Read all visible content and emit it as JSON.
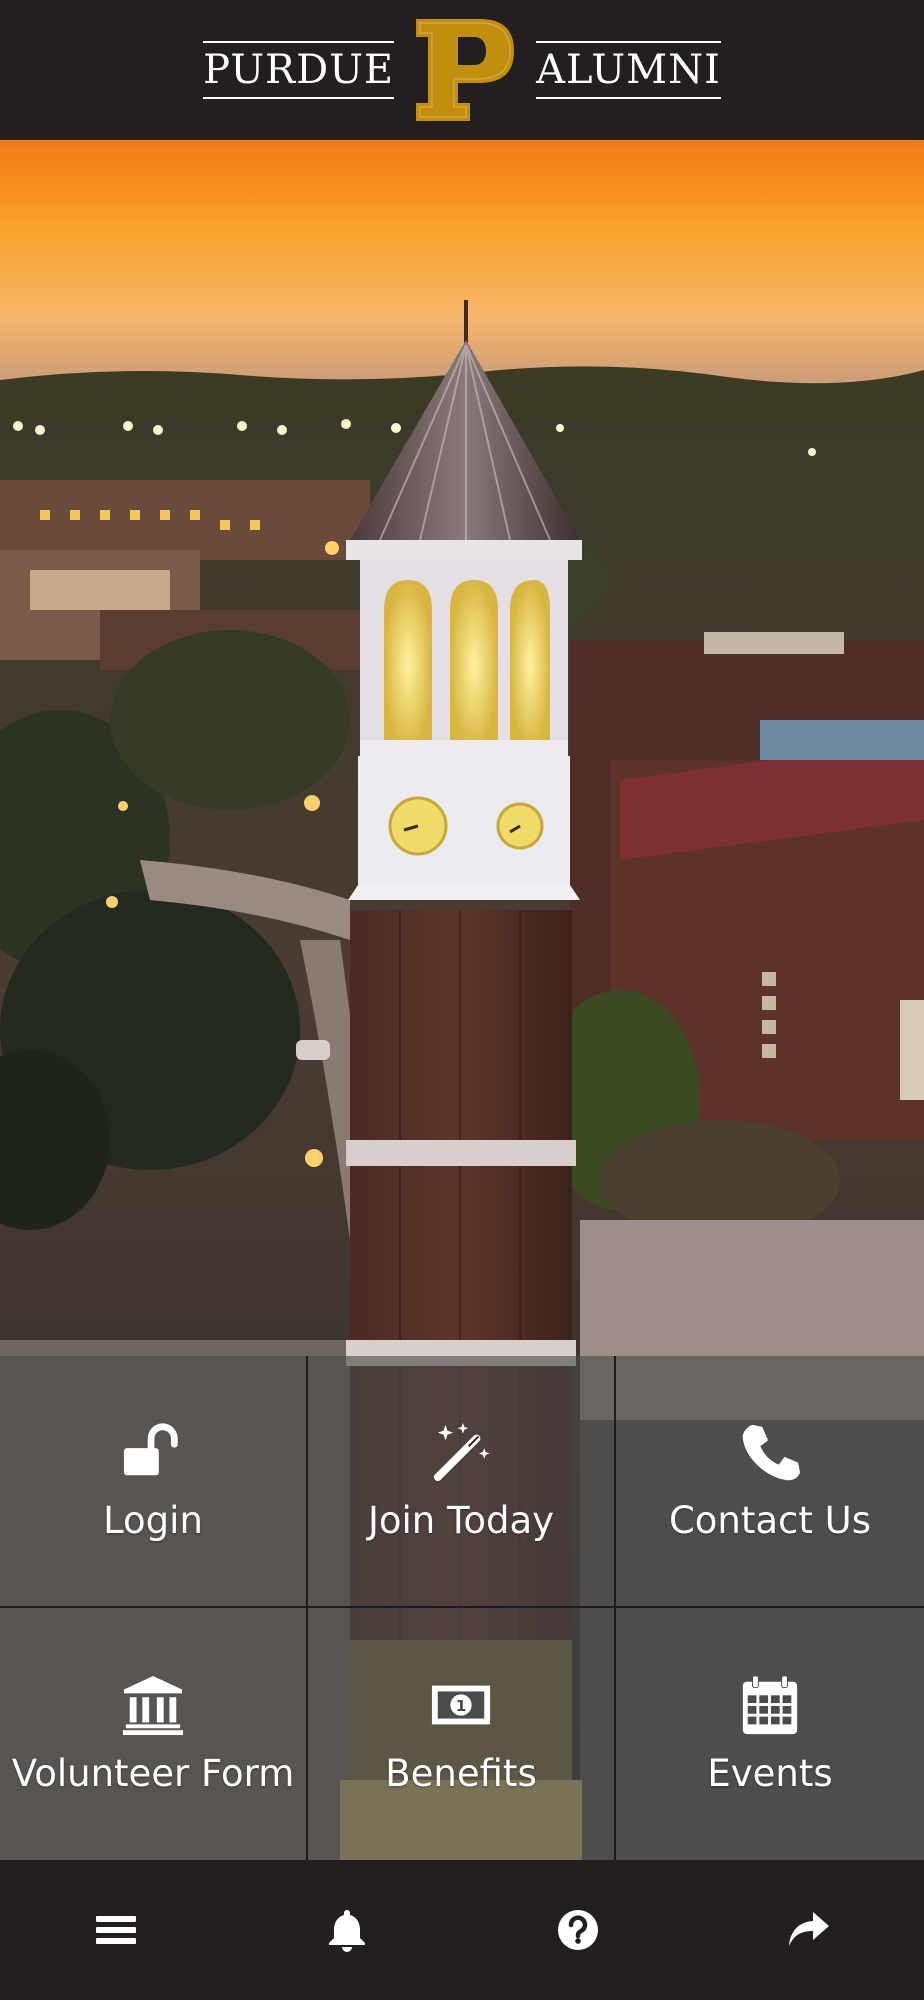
{
  "header": {
    "brand_left": "PURDUE",
    "brand_right": "ALUMNI",
    "logo_letter": "P"
  },
  "colors": {
    "bar_background": "#231f20",
    "purdue_gold": "#cfb991",
    "logo_gold": "#c28e0e",
    "tile_overlay": "rgba(75,75,75,0.62)",
    "text": "#ffffff"
  },
  "tiles": [
    {
      "label": "Login",
      "icon": "unlock-icon"
    },
    {
      "label": "Join Today",
      "icon": "magic-wand-icon"
    },
    {
      "label": "Contact Us",
      "icon": "phone-icon"
    },
    {
      "label": "Volunteer Form",
      "icon": "institution-icon"
    },
    {
      "label": "Benefits",
      "icon": "money-bill-icon"
    },
    {
      "label": "Events",
      "icon": "calendar-icon"
    }
  ],
  "toolbar": [
    {
      "name": "menu",
      "icon": "hamburger-menu-icon"
    },
    {
      "name": "notifications",
      "icon": "bell-icon"
    },
    {
      "name": "help",
      "icon": "question-circle-icon"
    },
    {
      "name": "share",
      "icon": "share-arrow-icon"
    }
  ]
}
